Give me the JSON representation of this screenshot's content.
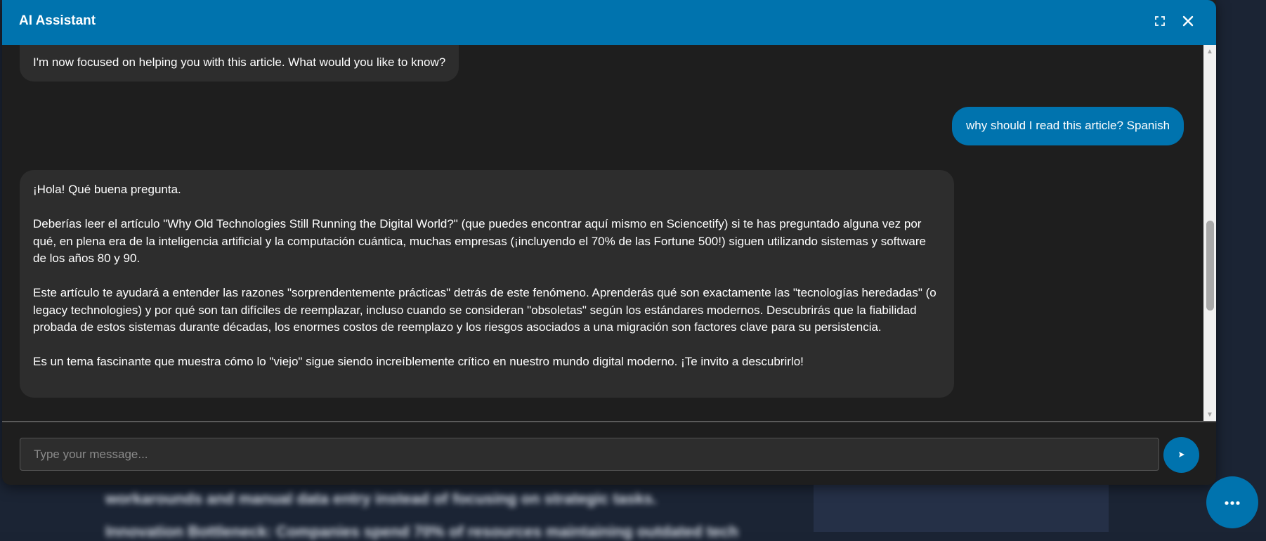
{
  "app": {
    "title": "AI Assistant"
  },
  "header": {
    "expand_icon": "expand-icon",
    "close_icon": "close-icon"
  },
  "messages": [
    {
      "role": "assistant",
      "text": "I'm now focused on helping you with this article. What would you like to know?"
    },
    {
      "role": "user",
      "text": "why should I read this article? Spanish"
    },
    {
      "role": "assistant",
      "paragraphs": [
        "¡Hola! Qué buena pregunta.",
        "Deberías leer el artículo \"Why Old Technologies Still Running the Digital World?\" (que puedes encontrar aquí mismo en Sciencetify) si te has preguntado alguna vez por qué, en plena era de la inteligencia artificial y la computación cuántica, muchas empresas (¡incluyendo el 70% de las Fortune 500!) siguen utilizando sistemas y software de los años 80 y 90.",
        "Este artículo te ayudará a entender las razones \"sorprendentemente prácticas\" detrás de este fenómeno. Aprenderás qué son exactamente las \"tecnologías heredadas\" (o legacy technologies) y por qué son tan difíciles de reemplazar, incluso cuando se consideran \"obsoletas\" según los estándares modernos. Descubrirás que la fiabilidad probada de estos sistemas durante décadas, los enormes costos de reemplazo y los riesgos asociados a una migración son factores clave para su persistencia.",
        "Es un tema fascinante que muestra cómo lo \"viejo\" sigue siendo increíblemente crítico en nuestro mundo digital moderno. ¡Te invito a descubrirlo!"
      ]
    }
  ],
  "input": {
    "placeholder": "Type your message...",
    "value": ""
  },
  "send_button": {
    "icon": "send-icon"
  },
  "background": {
    "line1": "workarounds and manual data entry instead of focusing on strategic tasks.",
    "line2": "Innovation Bottleneck: Companies spend 70% of resources maintaining outdated tech"
  },
  "colors": {
    "accent": "#0073ae",
    "panel": "#1e1e1e",
    "bot_bubble": "#2d2d2d"
  }
}
